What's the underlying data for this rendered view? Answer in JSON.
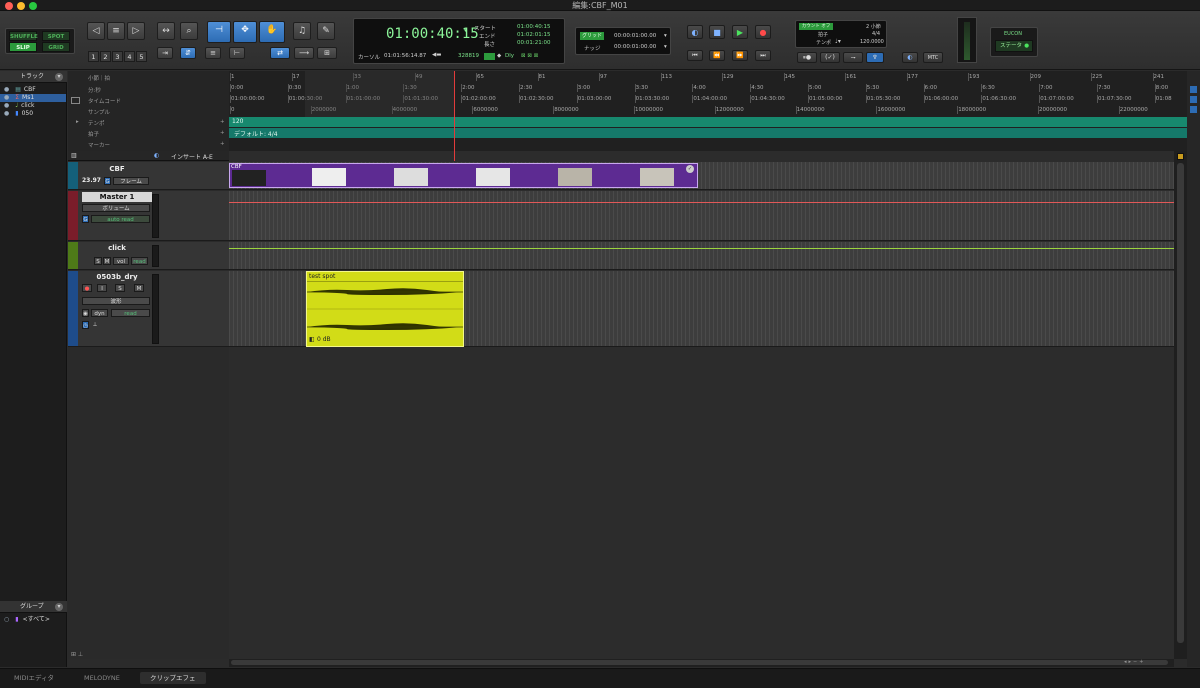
{
  "window": {
    "title": "編集:CBF_M01"
  },
  "modes": {
    "shuffle": "SHUFFLE",
    "spot": "SPOT",
    "slip": "SLIP",
    "grid": "GRID"
  },
  "zoom_presets": [
    "1",
    "2",
    "3",
    "4",
    "5"
  ],
  "counter": {
    "main": "01:00:40:15",
    "start_label": "スタート",
    "start": "01:00:40:15",
    "end_label": "エンド",
    "end": "01:02:01:15",
    "length_label": "長さ",
    "length": "00:01:21:00",
    "cursor_label": "カーソル",
    "cursor": "01:01:56:14.87",
    "samples": "328819",
    "dly": "Dly"
  },
  "grid_nudge": {
    "grid_label": "グリッド",
    "grid_value": "00:00:01:00.00",
    "nudge_label": "ナッジ",
    "nudge_value": "00:00:01:00.00"
  },
  "countoff": {
    "label": "カウント オフ",
    "bars": "2 小節",
    "meter_label": "拍子",
    "meter": "4/4",
    "tempo_label": "テンポ",
    "tempo": "120.0000"
  },
  "mtc": "MTC",
  "eucon": {
    "title": "EUCON",
    "status": "ステータ"
  },
  "tracks_panel": {
    "header": "トラック",
    "items": [
      "CBF",
      "Ms1",
      "click",
      "050"
    ]
  },
  "groups_panel": {
    "header": "グループ",
    "all": "<すべて>"
  },
  "rulers": {
    "labels": [
      "小節｜拍",
      "分:秒",
      "タイムコード",
      "サンプル",
      "テンポ",
      "拍子",
      "マーカー"
    ],
    "bars": [
      "1",
      "17",
      "33",
      "49",
      "65",
      "81",
      "97",
      "113",
      "129",
      "145",
      "161",
      "177",
      "193",
      "209",
      "225",
      "241"
    ],
    "minsecs": [
      "0:00",
      "0:30",
      "1:00",
      "1:30",
      "2:00",
      "2:30",
      "3:00",
      "3:30",
      "4:00",
      "4:30",
      "5:00",
      "5:30",
      "6:00",
      "6:30",
      "7:00",
      "7:30",
      "8:00"
    ],
    "timecode": [
      "01:00:00:00",
      "01:00:30:00",
      "01:01:00:00",
      "01:01:30:00",
      "01:02:00:00",
      "01:02:30:00",
      "01:03:00:00",
      "01:03:30:00",
      "01:04:00:00",
      "01:04:30:00",
      "01:05:00:00",
      "01:05:30:00",
      "01:06:00:00",
      "01:06:30:00",
      "01:07:00:00",
      "01:07:30:00",
      "01:08"
    ],
    "samples": [
      "0",
      "2000000",
      "4000000",
      "6000000",
      "8000000",
      "10000000",
      "12000000",
      "14000000",
      "16000000",
      "18000000",
      "20000000",
      "22000000"
    ],
    "tempo_value": "120",
    "meter_value": "デフォルト: 4/4"
  },
  "insert_header": "インサート A-E",
  "tracks": [
    {
      "name": "CBF",
      "fps": "23.97",
      "fps_mode": "フレーム",
      "clip": "CBF",
      "color": "#6b2fa3"
    },
    {
      "name": "Master 1",
      "view": "ボリューム",
      "auto": "auto read",
      "color": "#e25858"
    },
    {
      "name": "click",
      "s": "S",
      "m": "M",
      "view": "vol",
      "auto": "read",
      "color": "#8fd03b"
    },
    {
      "name": "0503b_dry",
      "i": "I",
      "s": "S",
      "m": "M",
      "view": "波形",
      "dyn": "dyn",
      "auto": "read",
      "clip": "test spot",
      "clip_gain": "0 dB",
      "color": "#d9e61b"
    }
  ],
  "bottom_tabs": [
    "MIDIエディタ",
    "MELODYNE",
    "クリップエフェ"
  ]
}
